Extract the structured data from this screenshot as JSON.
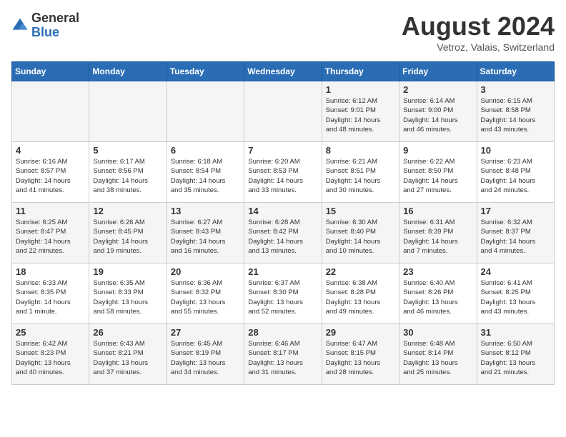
{
  "logo": {
    "general": "General",
    "blue": "Blue"
  },
  "title": {
    "month_year": "August 2024",
    "location": "Vetroz, Valais, Switzerland"
  },
  "days_of_week": [
    "Sunday",
    "Monday",
    "Tuesday",
    "Wednesday",
    "Thursday",
    "Friday",
    "Saturday"
  ],
  "weeks": [
    [
      {
        "day": "",
        "info": ""
      },
      {
        "day": "",
        "info": ""
      },
      {
        "day": "",
        "info": ""
      },
      {
        "day": "",
        "info": ""
      },
      {
        "day": "1",
        "info": "Sunrise: 6:12 AM\nSunset: 9:01 PM\nDaylight: 14 hours\nand 48 minutes."
      },
      {
        "day": "2",
        "info": "Sunrise: 6:14 AM\nSunset: 9:00 PM\nDaylight: 14 hours\nand 46 minutes."
      },
      {
        "day": "3",
        "info": "Sunrise: 6:15 AM\nSunset: 8:58 PM\nDaylight: 14 hours\nand 43 minutes."
      }
    ],
    [
      {
        "day": "4",
        "info": "Sunrise: 6:16 AM\nSunset: 8:57 PM\nDaylight: 14 hours\nand 41 minutes."
      },
      {
        "day": "5",
        "info": "Sunrise: 6:17 AM\nSunset: 8:56 PM\nDaylight: 14 hours\nand 38 minutes."
      },
      {
        "day": "6",
        "info": "Sunrise: 6:18 AM\nSunset: 8:54 PM\nDaylight: 14 hours\nand 35 minutes."
      },
      {
        "day": "7",
        "info": "Sunrise: 6:20 AM\nSunset: 8:53 PM\nDaylight: 14 hours\nand 33 minutes."
      },
      {
        "day": "8",
        "info": "Sunrise: 6:21 AM\nSunset: 8:51 PM\nDaylight: 14 hours\nand 30 minutes."
      },
      {
        "day": "9",
        "info": "Sunrise: 6:22 AM\nSunset: 8:50 PM\nDaylight: 14 hours\nand 27 minutes."
      },
      {
        "day": "10",
        "info": "Sunrise: 6:23 AM\nSunset: 8:48 PM\nDaylight: 14 hours\nand 24 minutes."
      }
    ],
    [
      {
        "day": "11",
        "info": "Sunrise: 6:25 AM\nSunset: 8:47 PM\nDaylight: 14 hours\nand 22 minutes."
      },
      {
        "day": "12",
        "info": "Sunrise: 6:26 AM\nSunset: 8:45 PM\nDaylight: 14 hours\nand 19 minutes."
      },
      {
        "day": "13",
        "info": "Sunrise: 6:27 AM\nSunset: 8:43 PM\nDaylight: 14 hours\nand 16 minutes."
      },
      {
        "day": "14",
        "info": "Sunrise: 6:28 AM\nSunset: 8:42 PM\nDaylight: 14 hours\nand 13 minutes."
      },
      {
        "day": "15",
        "info": "Sunrise: 6:30 AM\nSunset: 8:40 PM\nDaylight: 14 hours\nand 10 minutes."
      },
      {
        "day": "16",
        "info": "Sunrise: 6:31 AM\nSunset: 8:39 PM\nDaylight: 14 hours\nand 7 minutes."
      },
      {
        "day": "17",
        "info": "Sunrise: 6:32 AM\nSunset: 8:37 PM\nDaylight: 14 hours\nand 4 minutes."
      }
    ],
    [
      {
        "day": "18",
        "info": "Sunrise: 6:33 AM\nSunset: 8:35 PM\nDaylight: 14 hours\nand 1 minute."
      },
      {
        "day": "19",
        "info": "Sunrise: 6:35 AM\nSunset: 8:33 PM\nDaylight: 13 hours\nand 58 minutes."
      },
      {
        "day": "20",
        "info": "Sunrise: 6:36 AM\nSunset: 8:32 PM\nDaylight: 13 hours\nand 55 minutes."
      },
      {
        "day": "21",
        "info": "Sunrise: 6:37 AM\nSunset: 8:30 PM\nDaylight: 13 hours\nand 52 minutes."
      },
      {
        "day": "22",
        "info": "Sunrise: 6:38 AM\nSunset: 8:28 PM\nDaylight: 13 hours\nand 49 minutes."
      },
      {
        "day": "23",
        "info": "Sunrise: 6:40 AM\nSunset: 8:26 PM\nDaylight: 13 hours\nand 46 minutes."
      },
      {
        "day": "24",
        "info": "Sunrise: 6:41 AM\nSunset: 8:25 PM\nDaylight: 13 hours\nand 43 minutes."
      }
    ],
    [
      {
        "day": "25",
        "info": "Sunrise: 6:42 AM\nSunset: 8:23 PM\nDaylight: 13 hours\nand 40 minutes."
      },
      {
        "day": "26",
        "info": "Sunrise: 6:43 AM\nSunset: 8:21 PM\nDaylight: 13 hours\nand 37 minutes."
      },
      {
        "day": "27",
        "info": "Sunrise: 6:45 AM\nSunset: 8:19 PM\nDaylight: 13 hours\nand 34 minutes."
      },
      {
        "day": "28",
        "info": "Sunrise: 6:46 AM\nSunset: 8:17 PM\nDaylight: 13 hours\nand 31 minutes."
      },
      {
        "day": "29",
        "info": "Sunrise: 6:47 AM\nSunset: 8:15 PM\nDaylight: 13 hours\nand 28 minutes."
      },
      {
        "day": "30",
        "info": "Sunrise: 6:48 AM\nSunset: 8:14 PM\nDaylight: 13 hours\nand 25 minutes."
      },
      {
        "day": "31",
        "info": "Sunrise: 6:50 AM\nSunset: 8:12 PM\nDaylight: 13 hours\nand 21 minutes."
      }
    ]
  ]
}
